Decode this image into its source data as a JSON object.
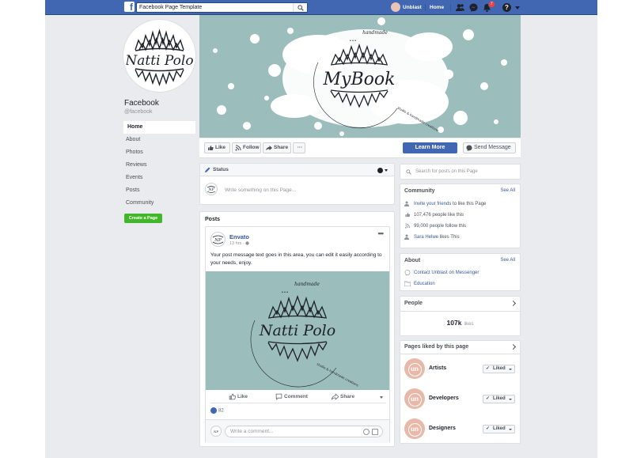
{
  "topbar": {
    "search_value": "Facebook Page Template",
    "user_name": "Unblast",
    "home_label": "Home",
    "notification_count": "7",
    "icons": [
      "facebook-logo-icon",
      "search-icon",
      "friends-icon",
      "messenger-icon",
      "notifications-icon",
      "help-icon",
      "caret-down-icon"
    ]
  },
  "profile": {
    "page_name": "Facebook",
    "handle": "@facebook",
    "logo_text": "Natti Polo"
  },
  "left_nav": {
    "items": [
      "Home",
      "About",
      "Photos",
      "Reviews",
      "Events",
      "Posts",
      "Community"
    ],
    "active": "Home",
    "create_button": "Create a Page"
  },
  "cover": {
    "logo_text": "MyBook",
    "top_small": "handmade",
    "arc_text": "studio & handmade creations"
  },
  "actions": {
    "like": "Like",
    "follow": "Follow",
    "share": "Share",
    "more": "···",
    "learn_more": "Learn More",
    "send_message": "Send Message"
  },
  "status": {
    "header": "Status",
    "placeholder": "Write something on this Page..."
  },
  "posts": {
    "title": "Posts",
    "author": "Envato",
    "time": "13 hrs",
    "more": "•••",
    "text": "Your post message text goes in this area, you can edit it easily according to your needs, enjoy.",
    "image_logo": "Natti Polo",
    "image_small": "handmade",
    "image_arc": "studio & handmade creations",
    "like": "Like",
    "comment": "Comment",
    "share": "Share",
    "reaction_count": "82",
    "comment_placeholder": "Write a comment..."
  },
  "right": {
    "search_placeholder": "Search for posts on this Page",
    "community": {
      "title": "Community",
      "see_all": "See All",
      "invite_link": "Invite your friends",
      "invite_rest": " to like this Page",
      "likes": "107,476 people like this",
      "follows": "99,000 people follow this",
      "friend_name": "Sara Helwe",
      "friend_rest": " likes This"
    },
    "about": {
      "title": "About",
      "see_all": "See All",
      "contact": "Contact Unblast on Messenger",
      "category": "Education"
    },
    "people": {
      "title": "People",
      "count": "107k",
      "count_label": "likes"
    },
    "liked": {
      "title": "Pages liked by this page",
      "items": [
        {
          "name": "Artists",
          "button": "Liked"
        },
        {
          "name": "Developers",
          "button": "Liked"
        },
        {
          "name": "Designers",
          "button": "Liked"
        }
      ],
      "avatar_text": "un"
    }
  },
  "colors": {
    "brand": "#4267b2",
    "cover_teal": "#9bbdbc",
    "create_green": "#42b72a",
    "avatar_peach": "#e8b9a8"
  }
}
